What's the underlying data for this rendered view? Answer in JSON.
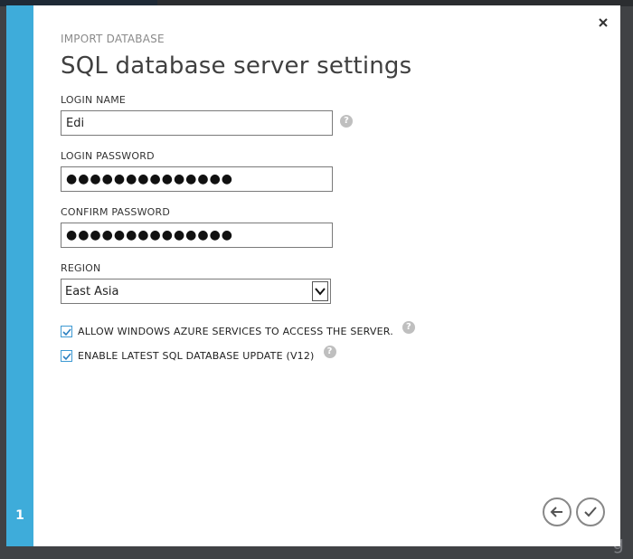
{
  "dialog": {
    "kicker": "IMPORT DATABASE",
    "title": "SQL database server settings",
    "step": "1"
  },
  "form": {
    "login_name": {
      "label": "LOGIN NAME",
      "value": "Edi"
    },
    "login_password": {
      "label": "LOGIN PASSWORD",
      "value": "●●●●●●●●●●●●●●"
    },
    "confirm_password": {
      "label": "CONFIRM PASSWORD",
      "value": "●●●●●●●●●●●●●●"
    },
    "region": {
      "label": "REGION",
      "value": "East Asia"
    },
    "options": [
      {
        "label": "ALLOW WINDOWS AZURE SERVICES TO ACCESS THE SERVER.",
        "checked": true
      },
      {
        "label": "ENABLE LATEST SQL DATABASE UPDATE (V12)",
        "checked": true
      }
    ]
  },
  "icons": {
    "close": "close-icon",
    "help": "help-icon",
    "back": "back-arrow-icon",
    "complete": "checkmark-icon",
    "dropdown": "chevron-down-icon"
  },
  "colors": {
    "accent": "#3eacda",
    "checkbox_border": "#3e9ad3"
  }
}
